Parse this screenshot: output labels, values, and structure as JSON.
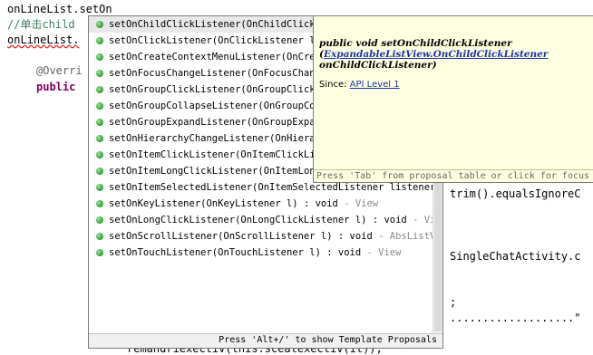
{
  "editor": {
    "lines": [
      {
        "text": "onLineList.setOn",
        "style": "plain"
      },
      {
        "text": "//单击child",
        "style": "comment"
      },
      {
        "text": "onLineList.",
        "style": "squiggle"
      },
      {
        "text": "@Overri",
        "style": "annot"
      },
      {
        "text": "public",
        "style": "kw"
      }
    ],
    "right_fragments": [
      "trim().equalsIgnoreC",
      "SingleChatActivity.c",
      ";",
      "...................\"",
      "remandriexectiv(this.sceatexectiv(it));"
    ]
  },
  "completion": {
    "items": [
      {
        "name": "setOnChildClickListener",
        "sig": "(OnChildClickLi",
        "src": ""
      },
      {
        "name": "setOnClickListener",
        "sig": "(OnClickListener l)",
        "src": ""
      },
      {
        "name": "setOnCreateContextMenuListener",
        "sig": "(OnCreate",
        "src": ""
      },
      {
        "name": "setOnFocusChangeListener",
        "sig": "(OnFocusChange",
        "src": ""
      },
      {
        "name": "setOnGroupClickListener",
        "sig": "(OnGroupClickLi",
        "src": ""
      },
      {
        "name": "setOnGroupCollapseListener",
        "sig": "(OnGroupColl",
        "src": ""
      },
      {
        "name": "setOnGroupExpandListener",
        "sig": "(OnGroupExpand",
        "src": ""
      },
      {
        "name": "setOnHierarchyChangeListener",
        "sig": "(OnHierarc",
        "src": ""
      },
      {
        "name": "setOnItemClickListener",
        "sig": "(OnItemClickLis",
        "src": ""
      },
      {
        "name": "setOnItemLongClickListener",
        "sig": "(OnItemLongC",
        "src": ""
      },
      {
        "name": "setOnItemSelectedListener",
        "sig": "(OnItemSelectedListener listener) :",
        "src": ""
      },
      {
        "name": "setOnKeyListener",
        "sig": "(OnKeyListener l) : void",
        "src": " - View"
      },
      {
        "name": "setOnLongClickListener",
        "sig": "(OnLongClickListener l) : void",
        "src": " - View"
      },
      {
        "name": "setOnScrollListener",
        "sig": "(OnScrollListener l) : void",
        "src": " - AbsListView"
      },
      {
        "name": "setOnTouchListener",
        "sig": "(OnTouchListener l) : void",
        "src": " - View"
      }
    ],
    "footer": "Press 'Alt+/' to show Template Proposals"
  },
  "javadoc": {
    "signature_prefix": "public void setOnChildClickListener",
    "param_link": "ExpandableListView.OnChildClickListener",
    "param_name": "onChildClickListener)",
    "since_label": "Since:",
    "since_link": "API Level 1",
    "footer": "Press 'Tab' from proposal table or click for focus"
  }
}
